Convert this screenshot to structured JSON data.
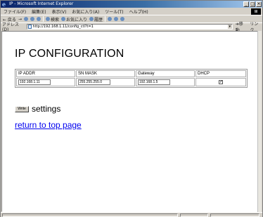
{
  "window": {
    "title": "IP - Microsoft Internet Explorer",
    "minimize": "_",
    "maximize": "□",
    "close": "×"
  },
  "menubar": {
    "items": [
      "ファイル(F)",
      "編集(E)",
      "表示(V)",
      "お気に入り(A)",
      "ツール(T)",
      "ヘルプ(H)"
    ]
  },
  "toolbar": {
    "back": "← 戻る",
    "forward": "→",
    "search": "検索",
    "favorites": "お気に入り",
    "history": "履歴"
  },
  "addressbar": {
    "label": "アドレス(D)",
    "url": "http://192.168.1.11/config_ctl?t=1",
    "go": "移動",
    "links": "リンク"
  },
  "page": {
    "title": "IP CONFIGURATION",
    "table": {
      "headers": [
        "IP ADDR",
        "SN MASK",
        "Gateway",
        "DHCP"
      ],
      "ip_addr": "192.168.1.11",
      "sn_mask": "255.255.255.0",
      "gateway": "192.168.1.5",
      "dhcp_checked": true
    },
    "write_button": "Write",
    "settings_label": "settings",
    "top_link": "return to top page"
  },
  "colors": {
    "link": "#0000ee",
    "titlebar": "#0a246a",
    "chrome": "#d4d0c8"
  }
}
